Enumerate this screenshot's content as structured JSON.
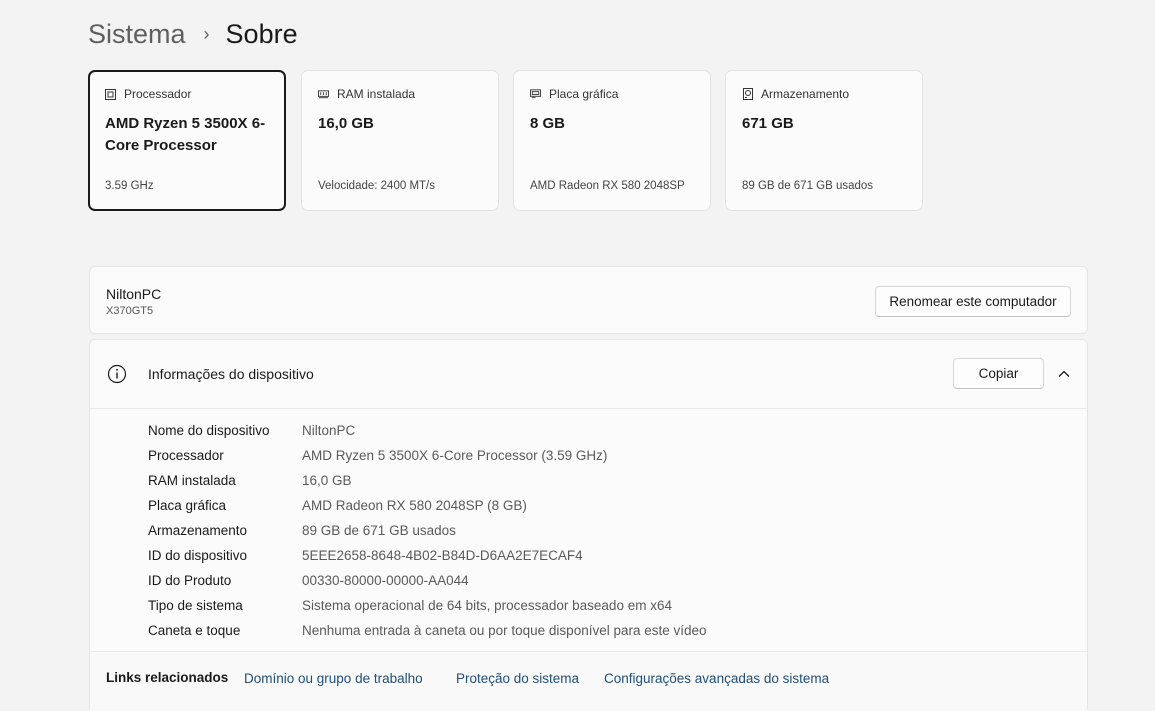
{
  "breadcrumb": {
    "parent": "Sistema",
    "separator": "›",
    "current": "Sobre"
  },
  "cards": [
    {
      "label": "Processador",
      "value": "AMD Ryzen 5 3500X 6-Core Processor",
      "sub": "3.59 GHz",
      "icon": "processor-icon"
    },
    {
      "label": "RAM instalada",
      "value": "16,0 GB",
      "sub": "Velocidade: 2400 MT/s",
      "icon": "ram-icon"
    },
    {
      "label": "Placa gráfica",
      "value": "8 GB",
      "sub": "AMD Radeon RX 580 2048SP",
      "icon": "graphics-card-icon"
    },
    {
      "label": "Armazenamento",
      "value": "671 GB",
      "sub": "89 GB de 671 GB usados",
      "icon": "storage-icon"
    }
  ],
  "pc": {
    "name": "NiltonPC",
    "model": "X370GT5",
    "rename_label": "Renomear este computador"
  },
  "device_info": {
    "title": "Informações do dispositivo",
    "copy_label": "Copiar",
    "rows": [
      {
        "label": "Nome do dispositivo",
        "value": "NiltonPC"
      },
      {
        "label": "Processador",
        "value": "AMD Ryzen 5 3500X 6-Core Processor (3.59 GHz)"
      },
      {
        "label": "RAM instalada",
        "value": "16,0 GB"
      },
      {
        "label": "Placa gráfica",
        "value": "AMD Radeon RX 580 2048SP (8 GB)"
      },
      {
        "label": "Armazenamento",
        "value": "89 GB de 671 GB usados"
      },
      {
        "label": "ID do dispositivo",
        "value": "5EEE2658-8648-4B02-B84D-D6AA2E7ECAF4"
      },
      {
        "label": "ID do Produto",
        "value": "00330-80000-00000-AA044"
      },
      {
        "label": "Tipo de sistema",
        "value": "Sistema operacional de 64 bits, processador baseado em x64"
      },
      {
        "label": "Caneta e toque",
        "value": "Nenhuma entrada à caneta ou por toque disponível para este vídeo"
      }
    ]
  },
  "related_links": {
    "title": "Links relacionados",
    "links": [
      "Domínio ou grupo de trabalho",
      "Proteção do sistema",
      "Configurações avançadas do sistema"
    ]
  },
  "colors": {
    "background": "#f3f3f3",
    "card": "#fbfbfb",
    "link": "#1d4f7a",
    "selected_border": "#1a1a1a"
  }
}
